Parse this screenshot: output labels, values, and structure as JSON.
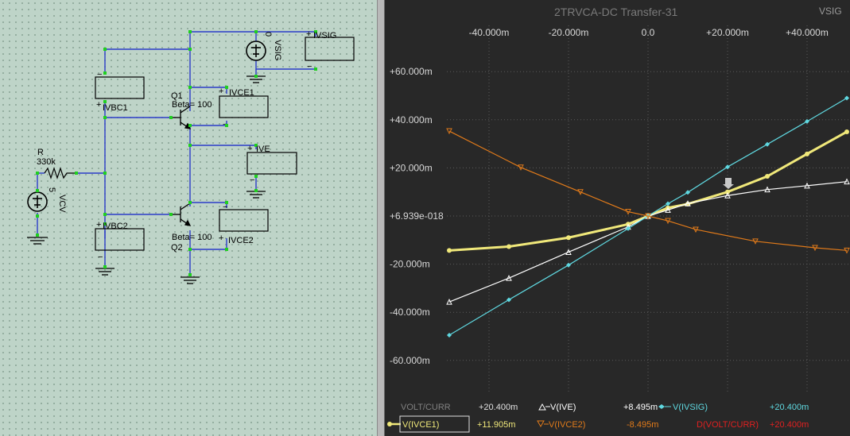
{
  "schematic": {
    "labels": {
      "r_name": "R",
      "r_value": "330k",
      "vcv_name": "VCV",
      "vcv_value": "5",
      "vsig_name": "VSIG",
      "vsig_value": "0",
      "q1_name": "Q1",
      "q1_beta": "Beta= 100",
      "q2_name": "Q2",
      "q2_beta": "Beta= 100",
      "meter_ivsig": "IVSIG",
      "meter_ivce1": "IVCE1",
      "meter_ive": "IVE",
      "meter_ivce2": "IVCE2",
      "meter_ivbc1": "IVBC1",
      "meter_ivbc2": "IVBC2"
    }
  },
  "plot": {
    "title": "2TRVCA-DC Transfer-31",
    "corner_label": "VSIG",
    "x_ticks": [
      "-40.000m",
      "-20.000m",
      "0.0",
      "+20.000m",
      "+40.000m"
    ],
    "y_ticks": [
      "+60.000m",
      "+40.000m",
      "+20.000m",
      "+6.939e-018",
      "-20.000m",
      "-40.000m",
      "-60.000m"
    ],
    "legend": {
      "row1": {
        "name": "VOLT/CURR",
        "value": "+20.400m"
      },
      "row1_s2": {
        "name": "V(IVE)",
        "value": "+8.495m"
      },
      "row1_s3": {
        "name": "V(IVSIG)",
        "value": "+20.400m"
      },
      "row2_s1": {
        "name": "V(IVCE1)",
        "value": "+11.905m"
      },
      "row2_s2": {
        "name": "V(IVCE2)",
        "value": "-8.495m"
      },
      "row2_s3": {
        "name": "D(VOLT/CURR)",
        "value": "+20.400m"
      }
    }
  },
  "colors": {
    "ivce1": "#f0e87a",
    "ive": "#ffffff",
    "ivsig": "#5fd8e0",
    "ivce2": "#e07a1a",
    "dvolt": "#e02020",
    "wire": "#2c3cc8",
    "node": "#20d020"
  },
  "chart_data": {
    "type": "line",
    "title": "2TRVCA-DC Transfer-31",
    "xlabel": "VSIG",
    "ylabel": "",
    "xlim": [
      -50,
      50
    ],
    "ylim": [
      -60,
      60
    ],
    "x_unit": "m",
    "y_unit": "m",
    "grid": true,
    "series": [
      {
        "name": "V(IVCE1)",
        "color": "#f0e87a",
        "marker": "dot",
        "x": [
          -50,
          -35,
          -20,
          -5,
          0,
          5,
          10,
          20,
          30,
          40,
          50
        ],
        "y": [
          -14.3,
          -12.7,
          -9,
          -3.4,
          0,
          3.4,
          5,
          10,
          16.5,
          25.8,
          35
        ]
      },
      {
        "name": "V(IVE)",
        "color": "#ffffff",
        "marker": "triangle-up",
        "x": [
          -50,
          -35,
          -20,
          -5,
          0,
          5,
          10,
          20,
          30,
          40,
          50
        ],
        "y": [
          -35.7,
          -25.8,
          -15,
          -4.5,
          0,
          2.5,
          5.2,
          8.5,
          11,
          12.6,
          14.3
        ]
      },
      {
        "name": "V(IVSIG)",
        "color": "#5fd8e0",
        "marker": "diamond",
        "x": [
          -50,
          -35,
          -20,
          -5,
          0,
          5,
          10,
          20,
          30,
          40,
          50
        ],
        "y": [
          -49.5,
          -34.8,
          -20.4,
          -5.2,
          0,
          5.1,
          9.8,
          20.4,
          29.8,
          39.3,
          49
        ]
      },
      {
        "name": "V(IVCE2)",
        "color": "#e07a1a",
        "marker": "triangle-down",
        "x": [
          -50,
          -32,
          -17,
          -5,
          0,
          5,
          12,
          27,
          42,
          50
        ],
        "y": [
          35.3,
          20.2,
          10,
          1.8,
          0,
          -2,
          -5.6,
          -10.5,
          -13.2,
          -14.3
        ]
      }
    ]
  }
}
